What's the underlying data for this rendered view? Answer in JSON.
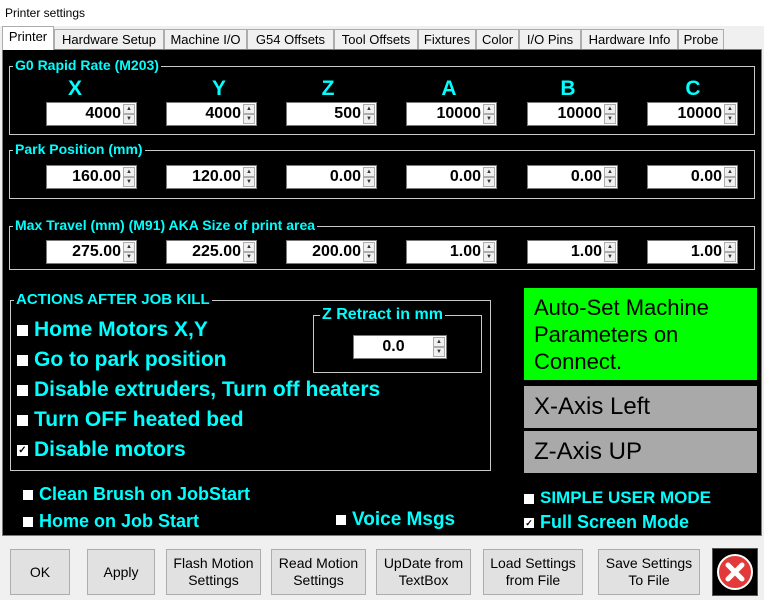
{
  "window": {
    "title": "Printer settings"
  },
  "tabs": [
    "Printer",
    "Hardware Setup",
    "Machine I/O",
    "G54 Offsets",
    "Tool Offsets",
    "Fixtures",
    "Color",
    "I/O Pins",
    "Hardware Info",
    "Probe"
  ],
  "axes": [
    "X",
    "Y",
    "Z",
    "A",
    "B",
    "C"
  ],
  "rapid": {
    "title": "G0 Rapid Rate    (M203)",
    "values": [
      "4000",
      "4000",
      "500",
      "10000",
      "10000",
      "10000"
    ]
  },
  "park": {
    "title": "Park Position (mm)",
    "values": [
      "160.00",
      "120.00",
      "0.00",
      "0.00",
      "0.00",
      "0.00"
    ]
  },
  "travel": {
    "title": "Max Travel (mm)   (M91)  AKA Size of print area",
    "values": [
      "275.00",
      "225.00",
      "200.00",
      "1.00",
      "1.00",
      "1.00"
    ]
  },
  "actions": {
    "title": "ACTIONS AFTER JOB KILL",
    "items": [
      {
        "label": "Home Motors X,Y",
        "checked": false
      },
      {
        "label": "Go to park position",
        "checked": false
      },
      {
        "label": "Disable extruders, Turn off heaters",
        "checked": false
      },
      {
        "label": "Turn OFF heated bed",
        "checked": false
      },
      {
        "label": "Disable motors",
        "checked": true
      }
    ],
    "zretract": {
      "title": "Z Retract in mm",
      "value": "0.0"
    }
  },
  "options": {
    "clean_brush": {
      "label": "Clean Brush on JobStart",
      "checked": false
    },
    "home_on_start": {
      "label": "Home on Job Start",
      "checked": false
    },
    "voice": {
      "label": "Voice Msgs",
      "checked": false
    },
    "simple_mode": {
      "label": "SIMPLE USER MODE",
      "checked": false
    },
    "full_screen": {
      "label": "Full Screen Mode",
      "checked": true
    }
  },
  "side_buttons": {
    "autoset": {
      "label": "Auto-Set Machine Parameters on Connect.",
      "color": "#00ff00"
    },
    "xaxis": {
      "label": "X-Axis Left",
      "color": "#a9a9a9"
    },
    "zaxis": {
      "label": "Z-Axis UP",
      "color": "#a9a9a9"
    }
  },
  "footer": {
    "ok": "OK",
    "apply": "Apply",
    "flash": "Flash Motion Settings",
    "read": "Read Motion Settings",
    "update": "UpDate from TextBox",
    "load": "Load Settings from File",
    "save": "Save Settings To File",
    "close_icon": "close-icon"
  },
  "colors": {
    "accent": "#00ffff",
    "background": "#000000",
    "close_red": "#e23a3a"
  }
}
